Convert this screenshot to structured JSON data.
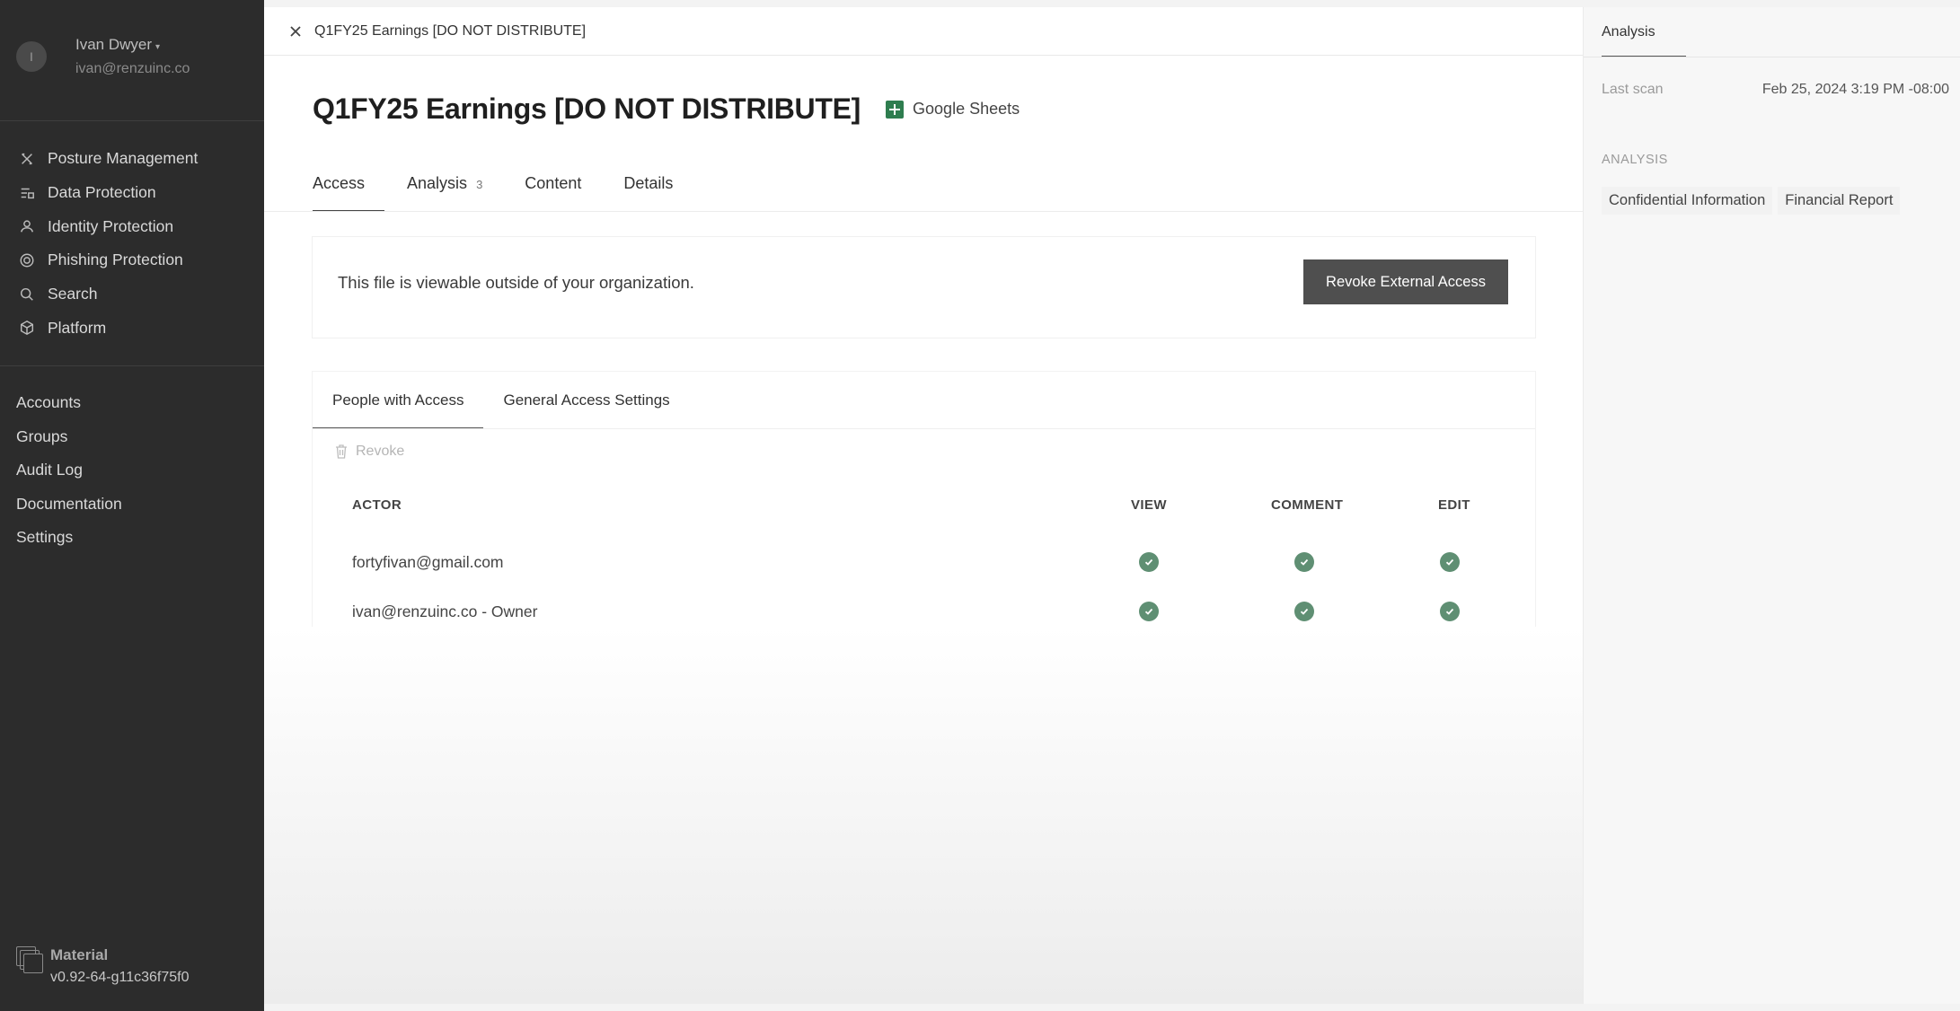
{
  "sidebar": {
    "user": {
      "initial": "I",
      "name": "Ivan Dwyer",
      "email": "ivan@renzuinc.co"
    },
    "nav": [
      {
        "label": "Posture Management",
        "icon": "posture-icon"
      },
      {
        "label": "Data Protection",
        "icon": "data-protection-icon"
      },
      {
        "label": "Identity Protection",
        "icon": "identity-icon"
      },
      {
        "label": "Phishing Protection",
        "icon": "phishing-icon"
      },
      {
        "label": "Search",
        "icon": "search-icon"
      },
      {
        "label": "Platform",
        "icon": "platform-icon"
      }
    ],
    "secondary": [
      "Accounts",
      "Groups",
      "Audit Log",
      "Documentation",
      "Settings"
    ],
    "brand": {
      "name": "Material",
      "version": "v0.92-64-g11c36f75f0"
    }
  },
  "topbar": {
    "title": "Q1FY25 Earnings [DO NOT DISTRIBUTE]"
  },
  "file": {
    "title": "Q1FY25 Earnings [DO NOT DISTRIBUTE]",
    "app": "Google Sheets"
  },
  "tabs": [
    {
      "label": "Access",
      "badge": ""
    },
    {
      "label": "Analysis",
      "badge": "3"
    },
    {
      "label": "Content",
      "badge": ""
    },
    {
      "label": "Details",
      "badge": ""
    }
  ],
  "alert": {
    "text": "This file is viewable outside of your organization.",
    "button": "Revoke External Access"
  },
  "people": {
    "tabs": [
      "People with Access",
      "General Access Settings"
    ],
    "revoke_label": "Revoke",
    "columns": {
      "actor": "ACTOR",
      "view": "VIEW",
      "comment": "COMMENT",
      "edit": "EDIT"
    },
    "rows": [
      {
        "actor": "fortyfivan@gmail.com",
        "view": true,
        "comment": true,
        "edit": true
      },
      {
        "actor": "ivan@renzuinc.co - Owner",
        "view": true,
        "comment": true,
        "edit": true
      }
    ]
  },
  "right_panel": {
    "tab": "Analysis",
    "last_scan_label": "Last scan",
    "last_scan_value": "Feb 25, 2024 3:19 PM -08:00",
    "analysis_label": "ANALYSIS",
    "tags": [
      "Confidential Information",
      "Financial Report"
    ]
  },
  "colors": {
    "sidebar": "#2c2c2c",
    "check": "#5f8f73",
    "button": "#4f4f4f",
    "sheets": "#2e7d4f"
  }
}
